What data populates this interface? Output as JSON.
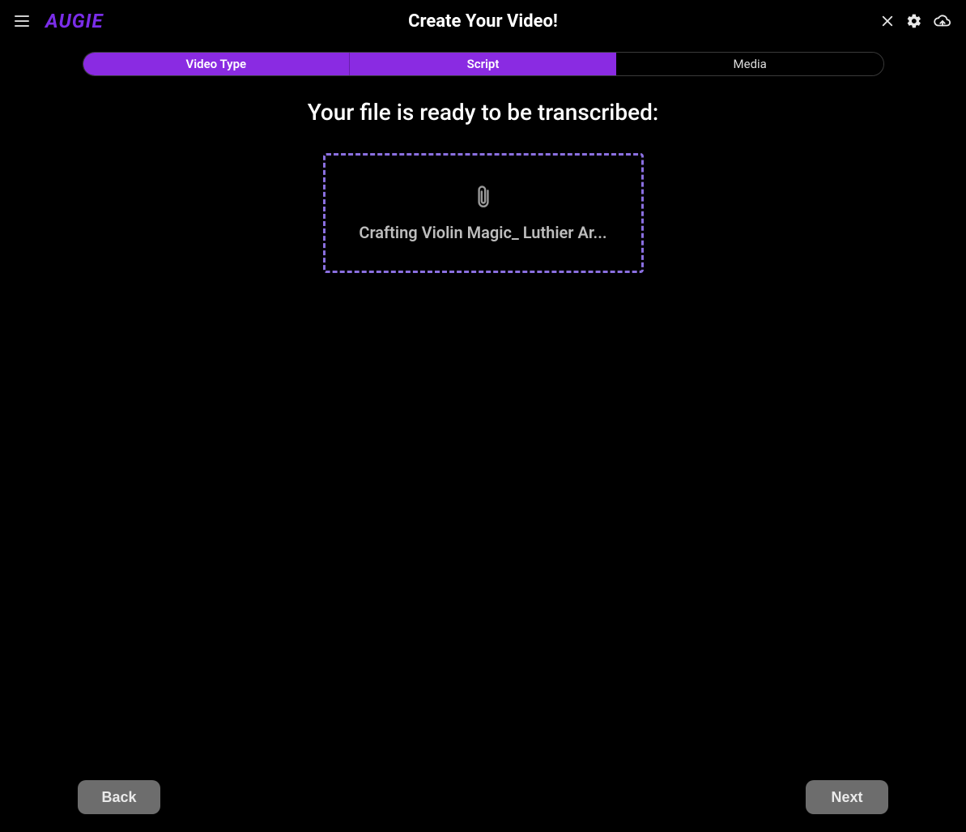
{
  "brand": "AUGIE",
  "header": {
    "title": "Create Your Video!"
  },
  "stepper": {
    "steps": [
      {
        "label": "Video Type",
        "active": true
      },
      {
        "label": "Script",
        "active": true
      },
      {
        "label": "Media",
        "active": false
      }
    ]
  },
  "main": {
    "heading": "Your file is ready to be transcribed:",
    "file": {
      "name": "Crafting Violin Magic_ Luthier Ar..."
    }
  },
  "footer": {
    "back": "Back",
    "next": "Next"
  },
  "colors": {
    "accent": "#8a2be2",
    "brand": "#7a2de8",
    "dashed_border": "#8a6fe0",
    "button_bg": "#6d6d6d"
  }
}
